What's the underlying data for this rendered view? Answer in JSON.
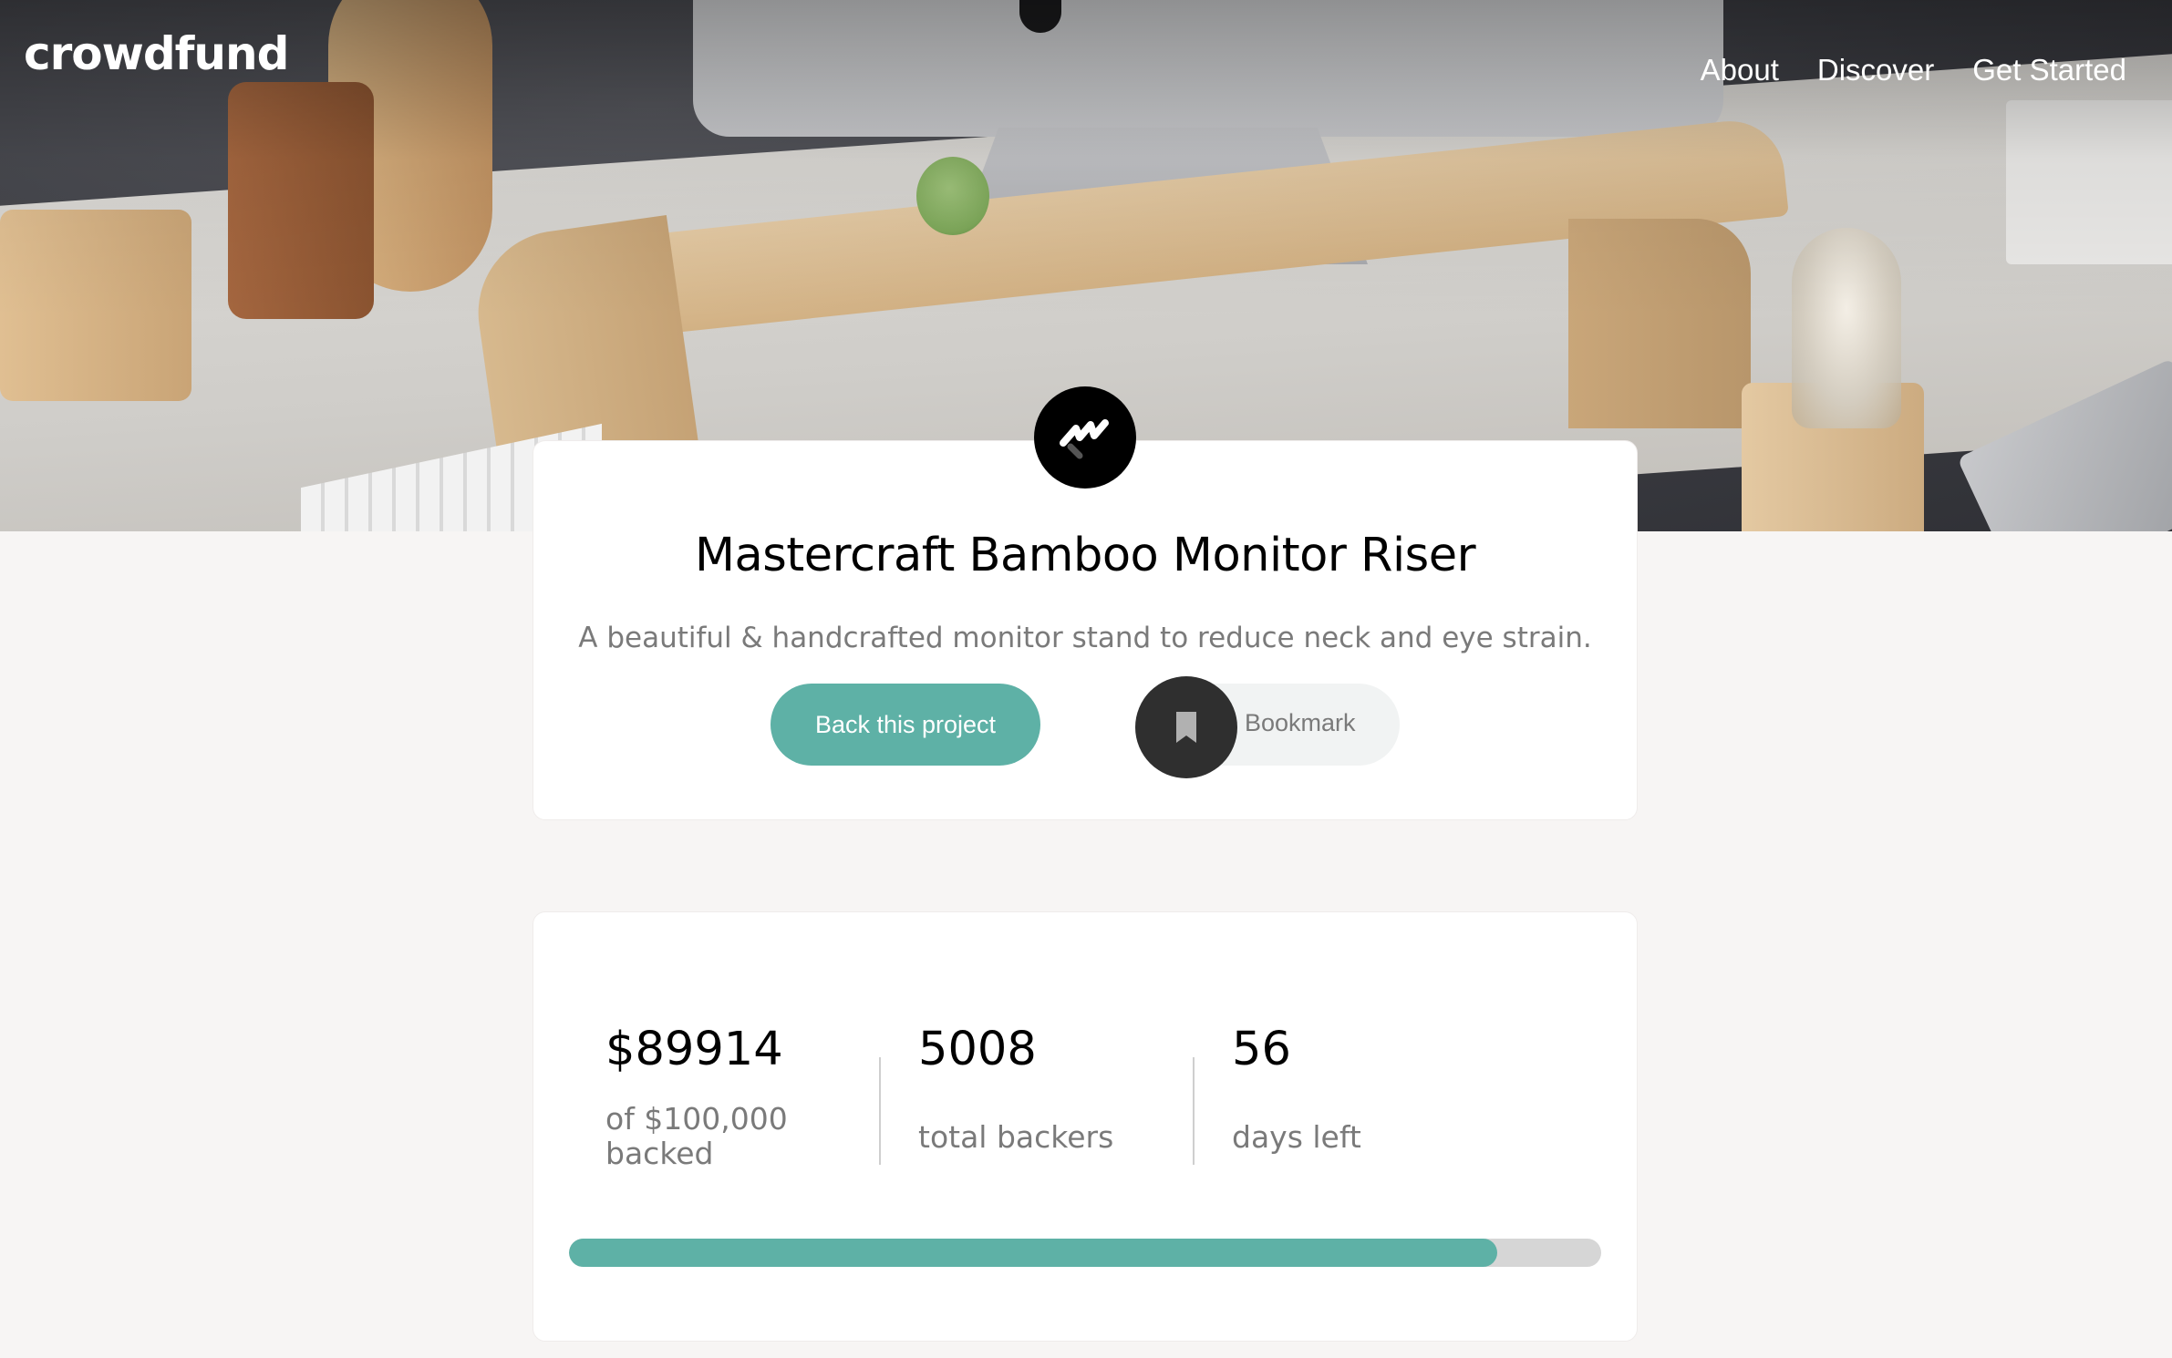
{
  "app": {
    "logo": "crowdfund"
  },
  "nav": {
    "items": [
      "About",
      "Discover",
      "Get Started"
    ]
  },
  "project": {
    "title": "Mastercraft Bamboo Monitor Riser",
    "description": "A beautiful & handcrafted monitor stand to reduce neck and eye strain.",
    "back_label": "Back this project",
    "bookmark_label": "Bookmark"
  },
  "stats": {
    "raised": "$89914",
    "raised_label": "of $100,000 backed",
    "backers": "5008",
    "backers_label": "total backers",
    "days": "56",
    "days_label": "days left",
    "progress": 0.899
  },
  "colors": {
    "accent": "#5eb1a6",
    "dark": "#2f2f2f",
    "background": "#f7f5f4"
  },
  "icons": {
    "logo_mark": "mastercraft-logo-icon",
    "bookmark": "bookmark-icon"
  }
}
